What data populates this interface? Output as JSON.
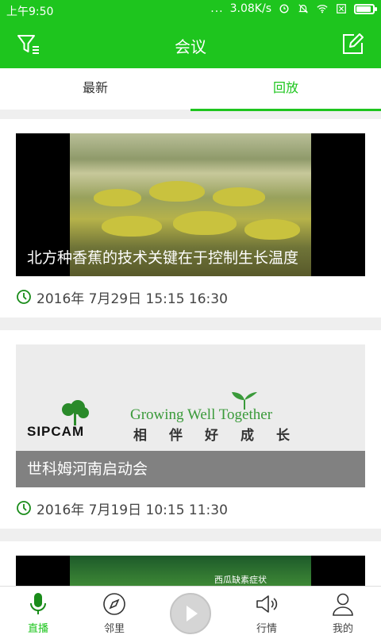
{
  "status_bar": {
    "time": "上午9:50",
    "more": "...",
    "net_speed": "3.08K/s"
  },
  "header": {
    "title": "会议",
    "left_icon": "filter-icon",
    "right_icon": "edit-icon"
  },
  "tabs": [
    {
      "label": "最新",
      "active": false
    },
    {
      "label": "回放",
      "active": true
    }
  ],
  "feed": [
    {
      "title": "北方种香蕉的技术关键在于控制生长温度",
      "datetime": "2016年 7月29日 15:15 16:30"
    },
    {
      "title": "世科姆河南启动会",
      "datetime": "2016年 7月19日 10:15 11:30",
      "thumb_brand": "SIPCAM",
      "thumb_tagline": "Growing Well Together",
      "thumb_cn": "相伴好成长"
    },
    {
      "thumb_label": "西瓜缺素症状"
    }
  ],
  "bottom_nav": [
    {
      "label": "直播",
      "icon": "microphone-icon",
      "active": true
    },
    {
      "label": "邻里",
      "icon": "compass-icon",
      "active": false
    },
    {
      "label": "",
      "icon": "play-icon",
      "active": false
    },
    {
      "label": "行情",
      "icon": "speaker-icon",
      "active": false
    },
    {
      "label": "我的",
      "icon": "user-icon",
      "active": false
    }
  ],
  "colors": {
    "brand_green": "#1ec51e"
  }
}
